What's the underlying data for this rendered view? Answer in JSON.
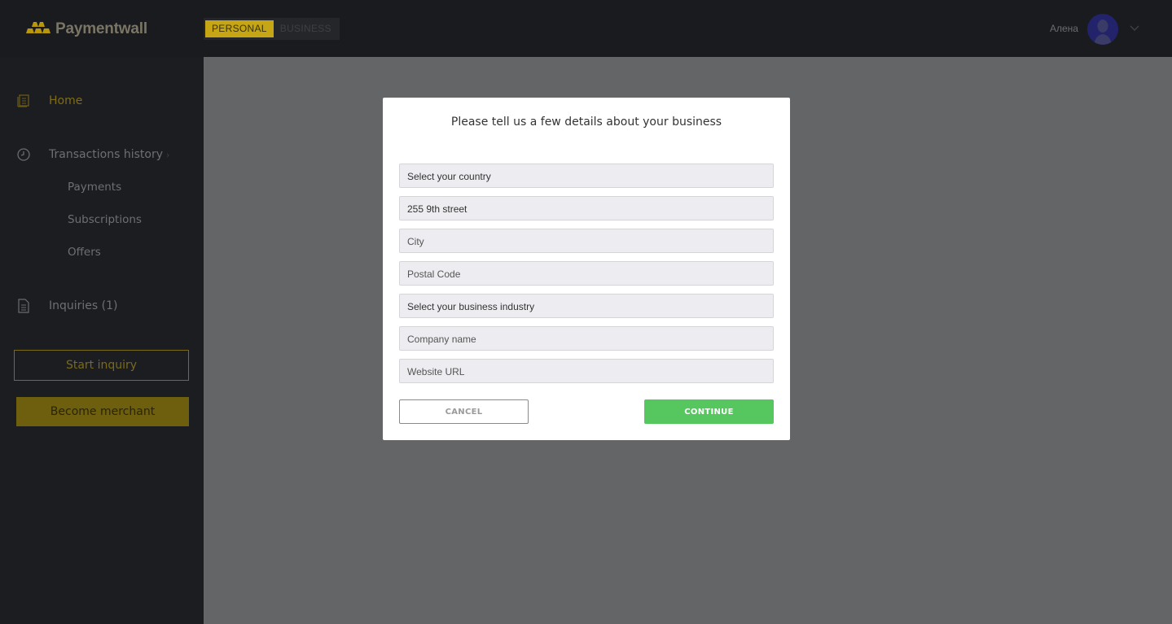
{
  "header": {
    "brand": "Paymentwall",
    "modes": [
      "PERSONAL",
      "BUSINESS"
    ],
    "active_mode": "PERSONAL",
    "user_name": "Алена"
  },
  "sidebar": {
    "items": [
      {
        "label": "Home",
        "icon": "home-icon",
        "active": true
      },
      {
        "label": "Transactions history",
        "icon": "clock-icon",
        "arrow": "›"
      },
      {
        "label": "Payments"
      },
      {
        "label": "Subscriptions"
      },
      {
        "label": "Offers"
      },
      {
        "label": "Inquiries (1)",
        "icon": "document-icon"
      }
    ],
    "start_inquiry": "Start inquiry",
    "become_merchant": "Become merchant"
  },
  "modal": {
    "title": "Please tell us a few details about your business",
    "fields": {
      "country": "Select your country",
      "street": "255 9th street",
      "city": "City",
      "postal_code": "Postal Code",
      "industry": "Select your business industry",
      "company": "Company name",
      "website": "Website URL"
    },
    "cancel": "CANCEL",
    "continue": "CONTINUE"
  },
  "colors": {
    "accent": "#c6a615",
    "continue_green": "#56c65f",
    "overlay": "#646567",
    "sidebar": "#1c1d21"
  }
}
